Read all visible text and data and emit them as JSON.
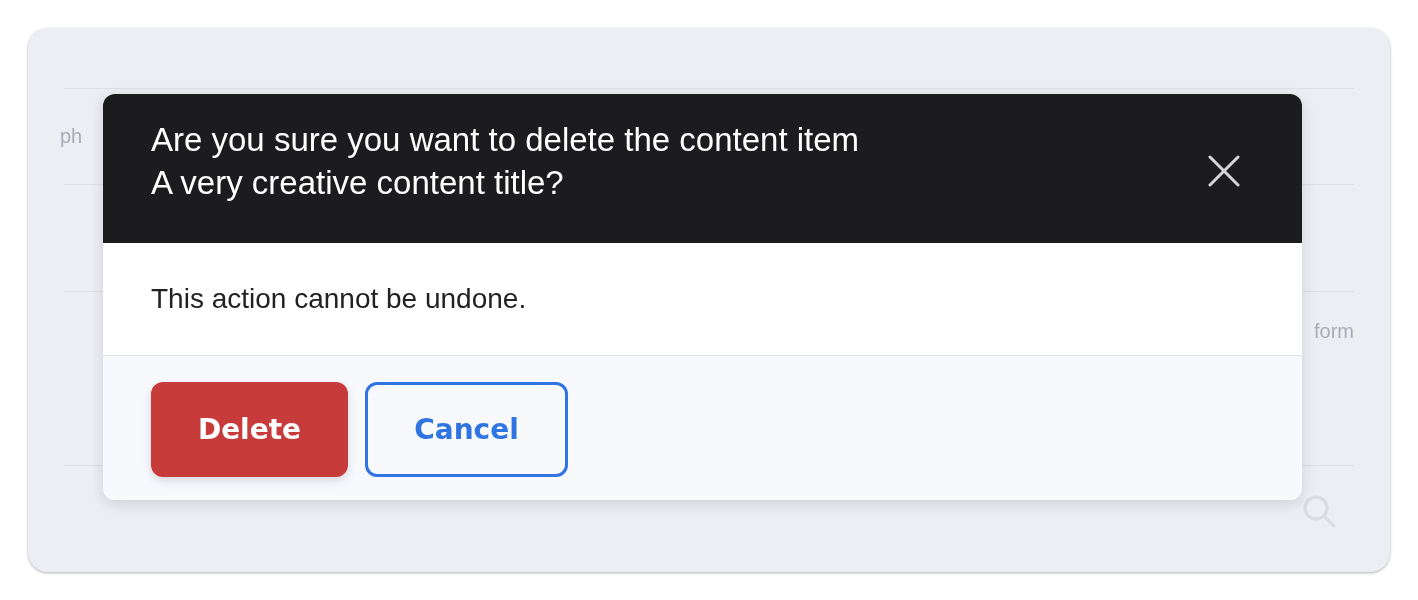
{
  "background": {
    "texts": [
      {
        "text": "ph"
      },
      {
        "text": "form"
      }
    ]
  },
  "dialog": {
    "title_lines": [
      "Are you sure you want to delete the content item",
      "A very creative content title?"
    ],
    "message": "This action cannot be undone.",
    "buttons": [
      {
        "label": "Delete",
        "kind": "danger"
      },
      {
        "label": "Cancel",
        "kind": "outline"
      }
    ]
  }
}
